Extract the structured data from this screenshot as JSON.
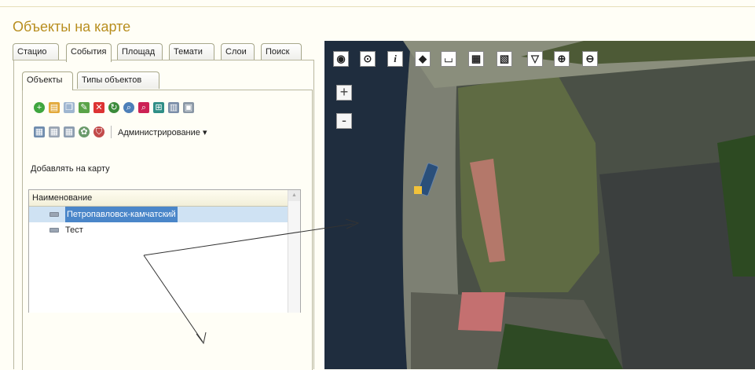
{
  "window": {
    "title": "Объекты на карте"
  },
  "outer_tabs": [
    "Стацио",
    "События",
    "Площад",
    "Темати",
    "Слои",
    "Поиск"
  ],
  "inner_tabs": [
    "Объекты",
    "Типы объектов"
  ],
  "toolbar2": {
    "admin_label": "Администрирование ▾"
  },
  "add_to_map": "Добавлять на карту",
  "grid": {
    "header": "Наименование",
    "rows": [
      {
        "name": "Петропавловск-камчатский",
        "selected": true
      },
      {
        "name": "Тест",
        "selected": false
      }
    ]
  },
  "map": {
    "toolbar_icons": [
      "globe-icon",
      "target-icon",
      "info-icon",
      "split-icon",
      "ruler-icon",
      "area-measure-icon",
      "area-measure2-icon",
      "filter-icon",
      "zoom-in-icon",
      "zoom-out-icon"
    ],
    "toolbar_glyphs": [
      "◉",
      "⊙",
      "i",
      "◆",
      "⌴",
      "▦",
      "▧",
      "▽",
      "⊕",
      "⊖"
    ],
    "zoom_in": "+",
    "zoom_out": "-"
  }
}
